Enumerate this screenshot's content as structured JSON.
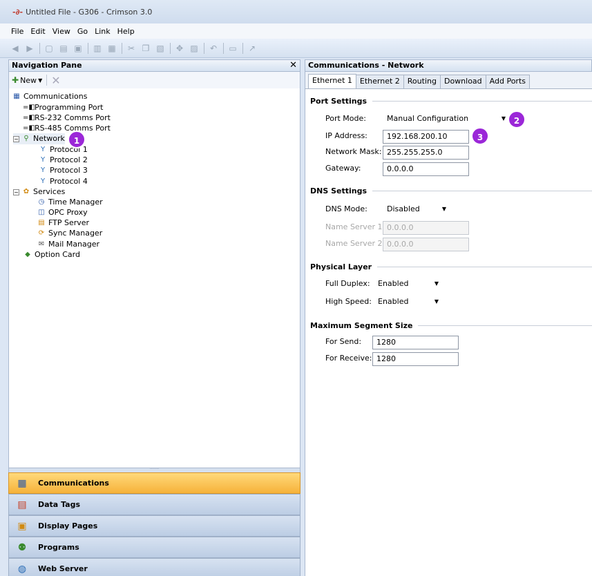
{
  "window": {
    "title": "Untitled File - G306 - Crimson 3.0"
  },
  "menu": [
    "File",
    "Edit",
    "View",
    "Go",
    "Link",
    "Help"
  ],
  "nav": {
    "header": "Navigation Pane",
    "new_label": "New",
    "tree": {
      "communications": "Communications",
      "programming_port": "Programming Port",
      "rs232": "RS-232 Comms Port",
      "rs485": "RS-485 Comms Port",
      "network": "Network",
      "protocols": [
        "Protocol 1",
        "Protocol 2",
        "Protocol 3",
        "Protocol 4"
      ],
      "services": "Services",
      "service_items": [
        "Time Manager",
        "OPC Proxy",
        "FTP Server",
        "Sync Manager",
        "Mail Manager"
      ],
      "option_card": "Option Card"
    },
    "categories": [
      "Communications",
      "Data Tags",
      "Display Pages",
      "Programs",
      "Web Server"
    ]
  },
  "right": {
    "header": "Communications - Network",
    "tabs": [
      "Ethernet 1",
      "Ethernet 2",
      "Routing",
      "Download",
      "Add Ports"
    ],
    "port_settings": {
      "title": "Port Settings",
      "port_mode_label": "Port Mode:",
      "port_mode": "Manual Configuration",
      "ip_label": "IP Address:",
      "ip": "192.168.200.10",
      "mask_label": "Network Mask:",
      "mask": "255.255.255.0",
      "gateway_label": "Gateway:",
      "gateway": "0.0.0.0"
    },
    "dns_settings": {
      "title": "DNS Settings",
      "mode_label": "DNS Mode:",
      "mode": "Disabled",
      "ns1_label": "Name Server 1:",
      "ns1": "0.0.0.0",
      "ns2_label": "Name Server 2:",
      "ns2": "0.0.0.0"
    },
    "physical_layer": {
      "title": "Physical Layer",
      "duplex_label": "Full Duplex:",
      "duplex": "Enabled",
      "speed_label": "High Speed:",
      "speed": "Enabled"
    },
    "segment_size": {
      "title": "Maximum Segment Size",
      "send_label": "For Send:",
      "send": "1280",
      "receive_label": "For Receive:",
      "receive": "1280"
    }
  },
  "badges": [
    "1",
    "2",
    "3"
  ],
  "colors": {
    "badge": "#9b27d8",
    "active_category": "#f6b23a"
  }
}
